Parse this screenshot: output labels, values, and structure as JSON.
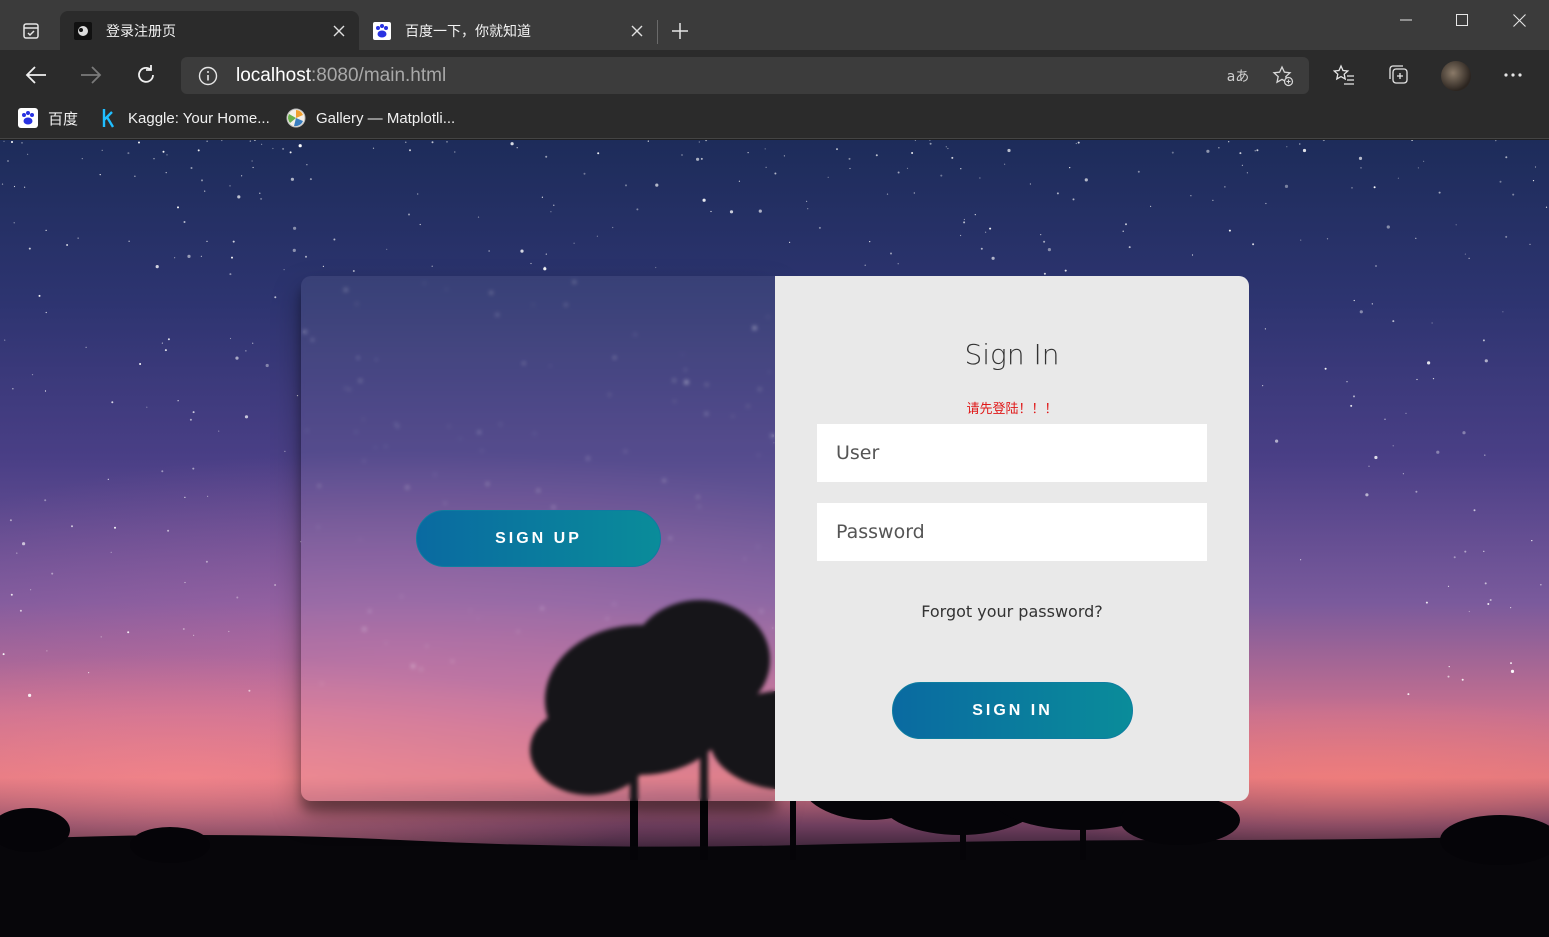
{
  "browser": {
    "tabs": [
      {
        "title": "登录注册页",
        "active": true,
        "favicon": "page-favicon"
      },
      {
        "title": "百度一下，你就知道",
        "active": false,
        "favicon": "baidu-paw-icon"
      }
    ],
    "url": {
      "host": "localhost",
      "rest": ":8080/main.html"
    },
    "translate_label": "aあ",
    "bookmarks": [
      {
        "label": "百度",
        "icon": "baidu-paw-icon"
      },
      {
        "label": "Kaggle: Your Home...",
        "icon": "kaggle-k-icon"
      },
      {
        "label": "Gallery — Matplotli...",
        "icon": "matplotlib-icon"
      }
    ]
  },
  "page": {
    "signup_button": "SIGN UP",
    "signin": {
      "title": "Sign In",
      "warning": "请先登陆！！！",
      "user_placeholder": "User",
      "password_placeholder": "Password",
      "forgot": "Forgot your password?",
      "button": "SIGN IN"
    }
  },
  "colors": {
    "accent_gradient_start": "#0a6aa1",
    "accent_gradient_end": "#0a8c9a",
    "warning": "#e01818",
    "card_bg": "#e9e9e9"
  }
}
